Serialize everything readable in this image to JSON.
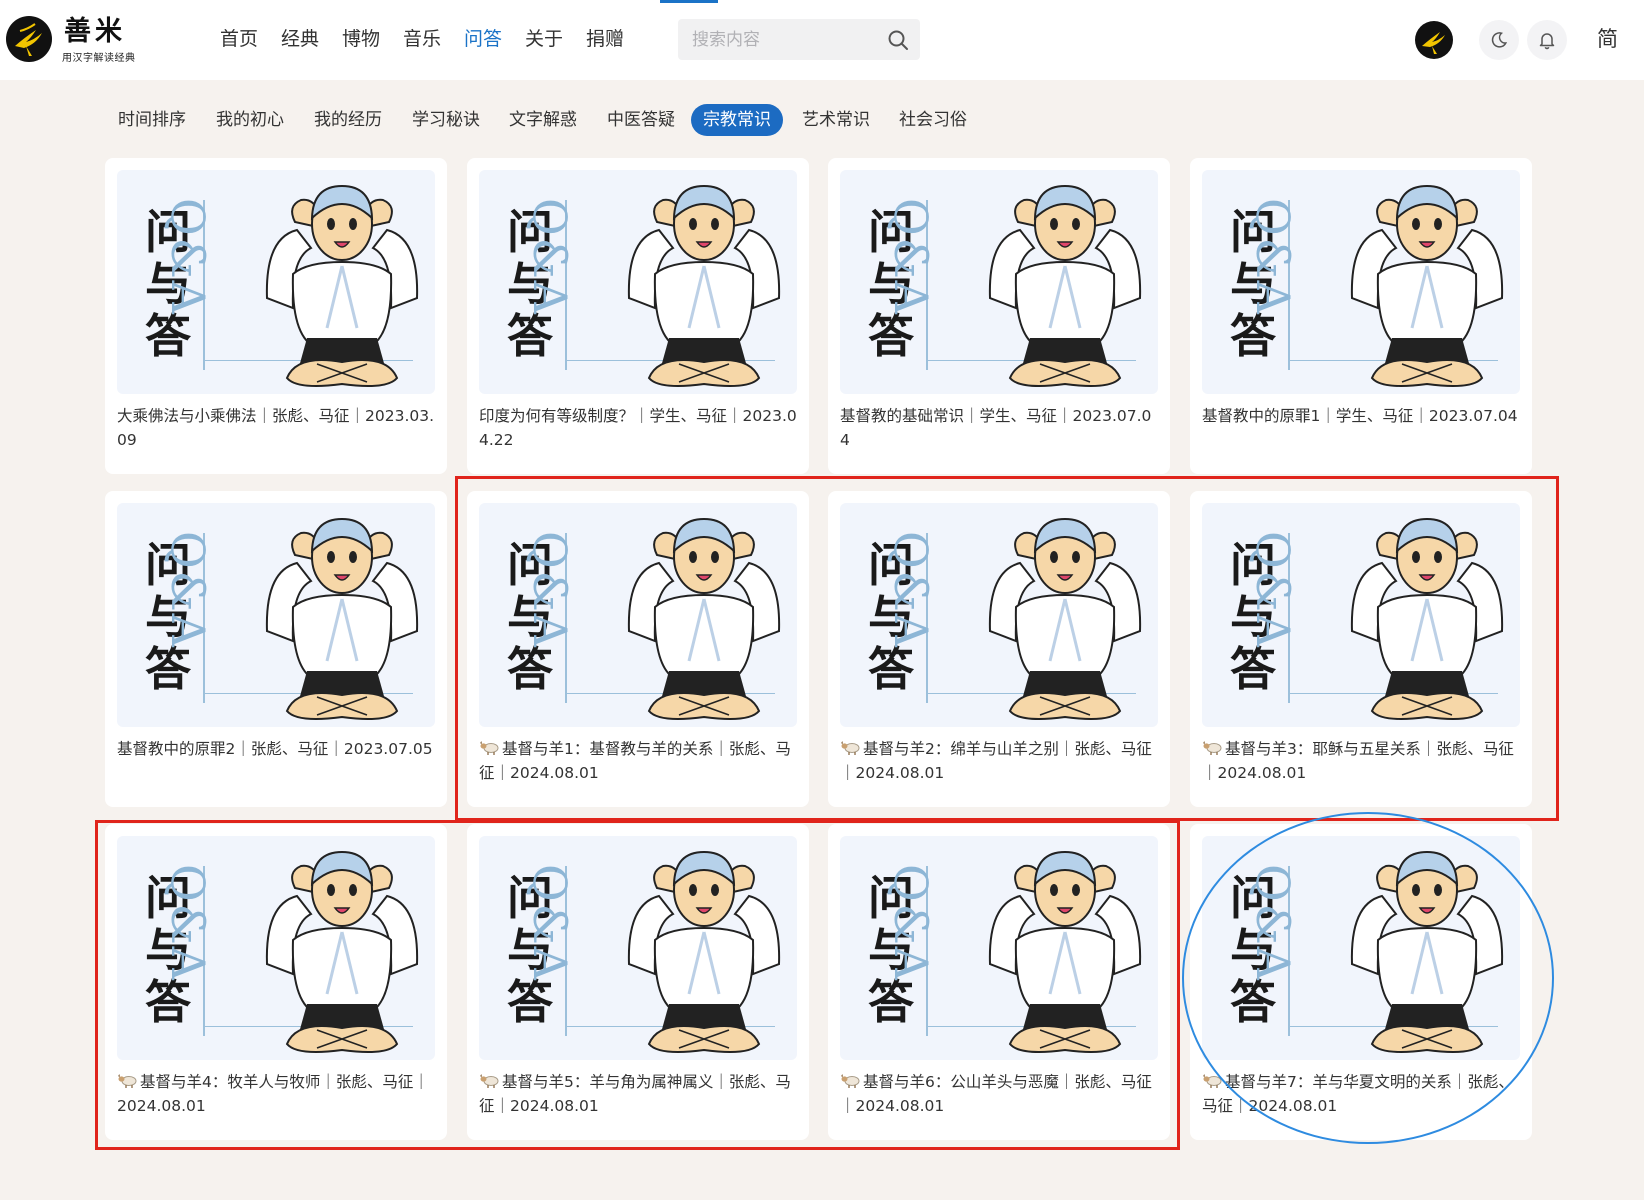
{
  "brand": {
    "name": "善米",
    "slogan": "用汉字解读经典"
  },
  "nav": {
    "items": [
      {
        "label": "首页",
        "active": false
      },
      {
        "label": "经典",
        "active": false
      },
      {
        "label": "博物",
        "active": false
      },
      {
        "label": "音乐",
        "active": false
      },
      {
        "label": "问答",
        "active": true
      },
      {
        "label": "关于",
        "active": false
      },
      {
        "label": "捐赠",
        "active": false
      }
    ]
  },
  "search": {
    "placeholder": "搜索内容",
    "icon": "search-icon"
  },
  "header_actions": {
    "theme_icon": "moon-icon",
    "notify_icon": "bell-icon",
    "language": "简"
  },
  "categories": [
    {
      "label": "时间排序",
      "active": false
    },
    {
      "label": "我的初心",
      "active": false
    },
    {
      "label": "我的经历",
      "active": false
    },
    {
      "label": "学习秘诀",
      "active": false
    },
    {
      "label": "文字解惑",
      "active": false
    },
    {
      "label": "中医答疑",
      "active": false
    },
    {
      "label": "宗教常识",
      "active": true
    },
    {
      "label": "艺术常识",
      "active": false
    },
    {
      "label": "社会习俗",
      "active": false
    }
  ],
  "thumbnail": {
    "title_chars": [
      "问",
      "与",
      "答"
    ],
    "subtitle": "Q&A"
  },
  "cards": [
    {
      "title": "大乘佛法与小乘佛法｜张彪、马征｜2023.03.09",
      "has_sheep": false
    },
    {
      "title": "印度为何有等级制度？｜学生、马征｜2023.04.22",
      "has_sheep": false
    },
    {
      "title": "基督教的基础常识｜学生、马征｜2023.07.04",
      "has_sheep": false
    },
    {
      "title": "基督教中的原罪1｜学生、马征｜2023.07.04",
      "has_sheep": false
    },
    {
      "title": "基督教中的原罪2｜张彪、马征｜2023.07.05",
      "has_sheep": false
    },
    {
      "title": "基督与羊1：基督教与羊的关系｜张彪、马征｜2024.08.01",
      "has_sheep": true
    },
    {
      "title": "基督与羊2：绵羊与山羊之别｜张彪、马征｜2024.08.01",
      "has_sheep": true
    },
    {
      "title": "基督与羊3：耶稣与五星关系｜张彪、马征｜2024.08.01",
      "has_sheep": true
    },
    {
      "title": "基督与羊4：牧羊人与牧师｜张彪、马征｜2024.08.01",
      "has_sheep": true
    },
    {
      "title": "基督与羊5：羊与角为属神属义｜张彪、马征｜2024.08.01",
      "has_sheep": true
    },
    {
      "title": "基督与羊6：公山羊头与恶魔｜张彪、马征｜2024.08.01",
      "has_sheep": true
    },
    {
      "title": "基督与羊7：羊与华夏文明的关系｜张彪、马征｜2024.08.01",
      "has_sheep": true
    }
  ],
  "colors": {
    "accent": "#1c6bc2",
    "annotation_red": "#e0241b",
    "annotation_blue": "#2e8be0",
    "qa_blue": "#8db6d6"
  }
}
